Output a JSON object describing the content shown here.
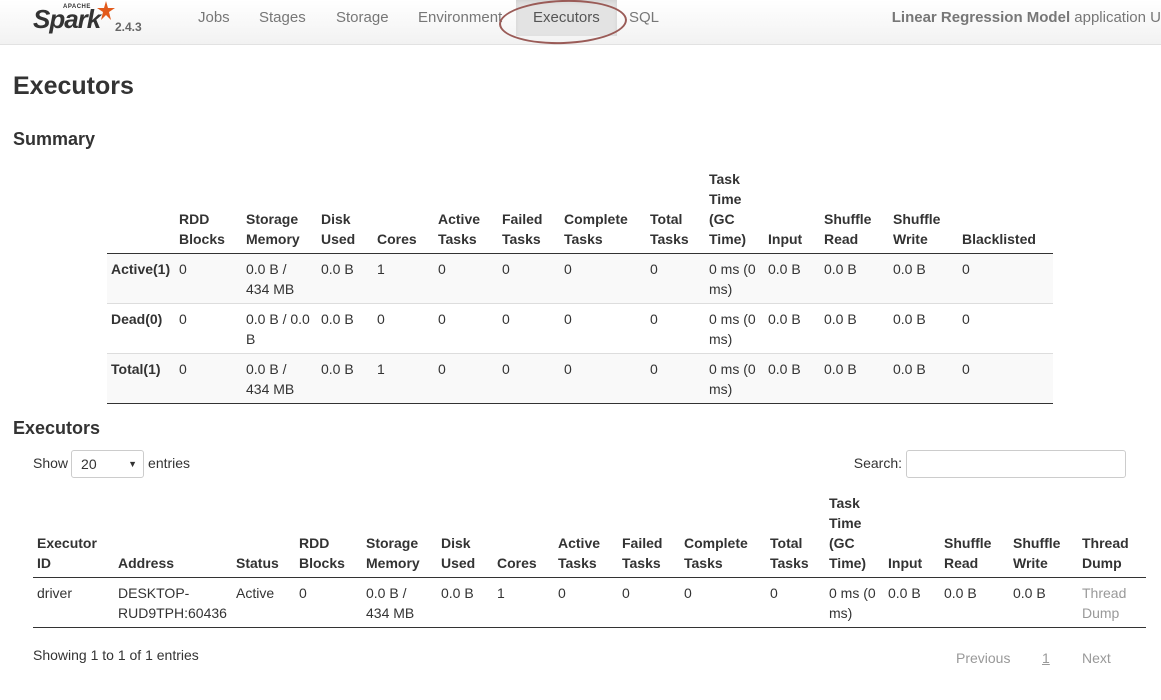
{
  "nav": {
    "brand_apache": "APACHE",
    "brand_name": "Spark",
    "version": "2.4.3",
    "items": [
      {
        "label": "Jobs"
      },
      {
        "label": "Stages"
      },
      {
        "label": "Storage"
      },
      {
        "label": "Environment"
      },
      {
        "label": "Executors",
        "active": true
      },
      {
        "label": "SQL"
      }
    ],
    "app_name": "Linear Regression Model",
    "app_suffix": " application U"
  },
  "page_title": "Executors",
  "summary": {
    "title": "Summary",
    "headers": [
      "",
      "RDD Blocks",
      "Storage Memory",
      "Disk Used",
      "Cores",
      "Active Tasks",
      "Failed Tasks",
      "Complete Tasks",
      "Total Tasks",
      "Task Time (GC Time)",
      "Input",
      "Shuffle Read",
      "Shuffle Write",
      "Blacklisted"
    ],
    "rows": [
      [
        "Active(1)",
        "0",
        "0.0 B / 434 MB",
        "0.0 B",
        "1",
        "0",
        "0",
        "0",
        "0",
        "0 ms (0 ms)",
        "0.0 B",
        "0.0 B",
        "0.0 B",
        "0"
      ],
      [
        "Dead(0)",
        "0",
        "0.0 B / 0.0 B",
        "0.0 B",
        "0",
        "0",
        "0",
        "0",
        "0",
        "0 ms (0 ms)",
        "0.0 B",
        "0.0 B",
        "0.0 B",
        "0"
      ],
      [
        "Total(1)",
        "0",
        "0.0 B / 434 MB",
        "0.0 B",
        "1",
        "0",
        "0",
        "0",
        "0",
        "0 ms (0 ms)",
        "0.0 B",
        "0.0 B",
        "0.0 B",
        "0"
      ]
    ]
  },
  "executors": {
    "title": "Executors",
    "show_label": "Show",
    "entries_value": "20",
    "entries_label": "entries",
    "search_label": "Search:",
    "search_value": "",
    "headers": [
      "Executor ID",
      "Address",
      "Status",
      "RDD Blocks",
      "Storage Memory",
      "Disk Used",
      "Cores",
      "Active Tasks",
      "Failed Tasks",
      "Complete Tasks",
      "Total Tasks",
      "Task Time (GC Time)",
      "Input",
      "Shuffle Read",
      "Shuffle Write",
      "Thread Dump"
    ],
    "rows": [
      [
        "driver",
        "DESKTOP-RUD9TPH:60436",
        "Active",
        "0",
        "0.0 B / 434 MB",
        "0.0 B",
        "1",
        "0",
        "0",
        "0",
        "0",
        "0 ms (0 ms)",
        "0.0 B",
        "0.0 B",
        "0.0 B",
        "Thread Dump"
      ]
    ],
    "info": "Showing 1 to 1 of 1 entries",
    "pager": {
      "previous": "Previous",
      "page": "1",
      "next": "Next"
    }
  },
  "colors": {
    "link_muted": "#999999",
    "annotation_circle": "#9a5b57"
  }
}
